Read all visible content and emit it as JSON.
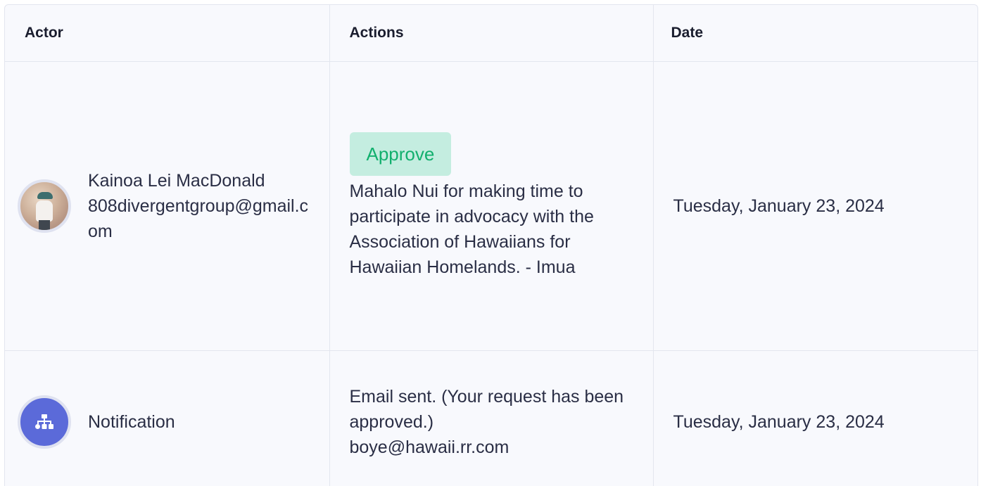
{
  "table": {
    "headers": {
      "actor": "Actor",
      "actions": "Actions",
      "date": "Date"
    },
    "rows": [
      {
        "actor_name": "Kainoa Lei MacDonald",
        "actor_email": "808divergentgroup@gmail.com",
        "avatar": "user-photo",
        "action_badge": "Approve",
        "action_badge_color": "#12b06e",
        "action_text": "Mahalo Nui for making time to participate in advocacy with the Association of Hawaiians for Hawaiian Homelands. - Imua",
        "date": "Tuesday, January 23, 2024"
      },
      {
        "actor_name": "Notification",
        "avatar": "sitemap-icon",
        "action_text_line1": "Email sent. (Your request has been approved.)",
        "action_text_line2": "boye@hawaii.rr.com",
        "date": "Tuesday, January 23, 2024"
      }
    ]
  },
  "colors": {
    "accent": "#5b6ad9",
    "approve_bg": "#c4ede0",
    "approve_text": "#12b06e",
    "table_bg": "#f8f9fd",
    "border": "#e3e6ef"
  }
}
